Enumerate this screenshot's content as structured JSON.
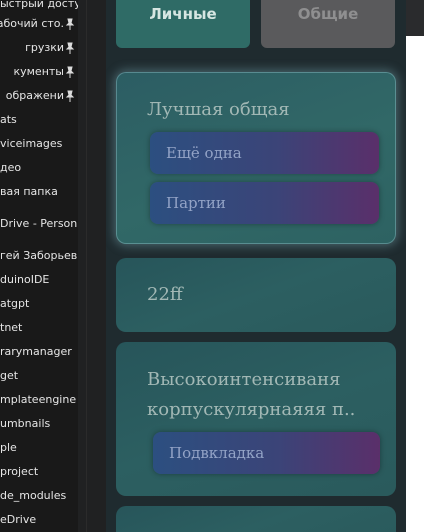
{
  "sidebar": {
    "items": [
      {
        "label": "ыстрый доступ",
        "pinned": false
      },
      {
        "label": "абочий сто.",
        "pinned": true
      },
      {
        "label": "грузки",
        "pinned": true
      },
      {
        "label": "кументы",
        "pinned": true
      },
      {
        "label": "ображени",
        "pinned": true
      },
      {
        "label": "ats",
        "pinned": false
      },
      {
        "label": "viceimages",
        "pinned": false
      },
      {
        "label": "део",
        "pinned": false
      },
      {
        "label": "вая папка",
        "pinned": false
      },
      {
        "label": "Drive - Person",
        "pinned": false
      },
      {
        "label": "гей Заборьев",
        "pinned": false
      },
      {
        "label": "duinoIDE",
        "pinned": false
      },
      {
        "label": "atgpt",
        "pinned": false
      },
      {
        "label": "tnet",
        "pinned": false
      },
      {
        "label": "rarymanager",
        "pinned": false
      },
      {
        "label": "get",
        "pinned": false
      },
      {
        "label": "mplateengine",
        "pinned": false
      },
      {
        "label": "umbnails",
        "pinned": false
      },
      {
        "label": "ple",
        "pinned": false
      },
      {
        "label": "project",
        "pinned": false
      },
      {
        "label": "de_modules",
        "pinned": false
      },
      {
        "label": "eDrive",
        "pinned": false
      }
    ]
  },
  "tabs": {
    "personal": "Личные",
    "common": "Общие"
  },
  "cards": [
    {
      "title": "Лучшая общая",
      "items": [
        "Ещё одна",
        "Партии"
      ]
    },
    {
      "title": "22ff",
      "items": []
    },
    {
      "title_line1": "Высокоинтенсиваня",
      "title_line2": "корпускулярнаяяя п..",
      "items": [
        "Подвкладка"
      ]
    }
  ],
  "colors": {
    "main_bg": "#1f2b2f",
    "card_bg": "#2c5f61",
    "tab_active": "#2f6b66",
    "tab_inactive": "#5a5a5c",
    "chip_start": "#2c4f80",
    "chip_end": "#5a2f6a"
  }
}
